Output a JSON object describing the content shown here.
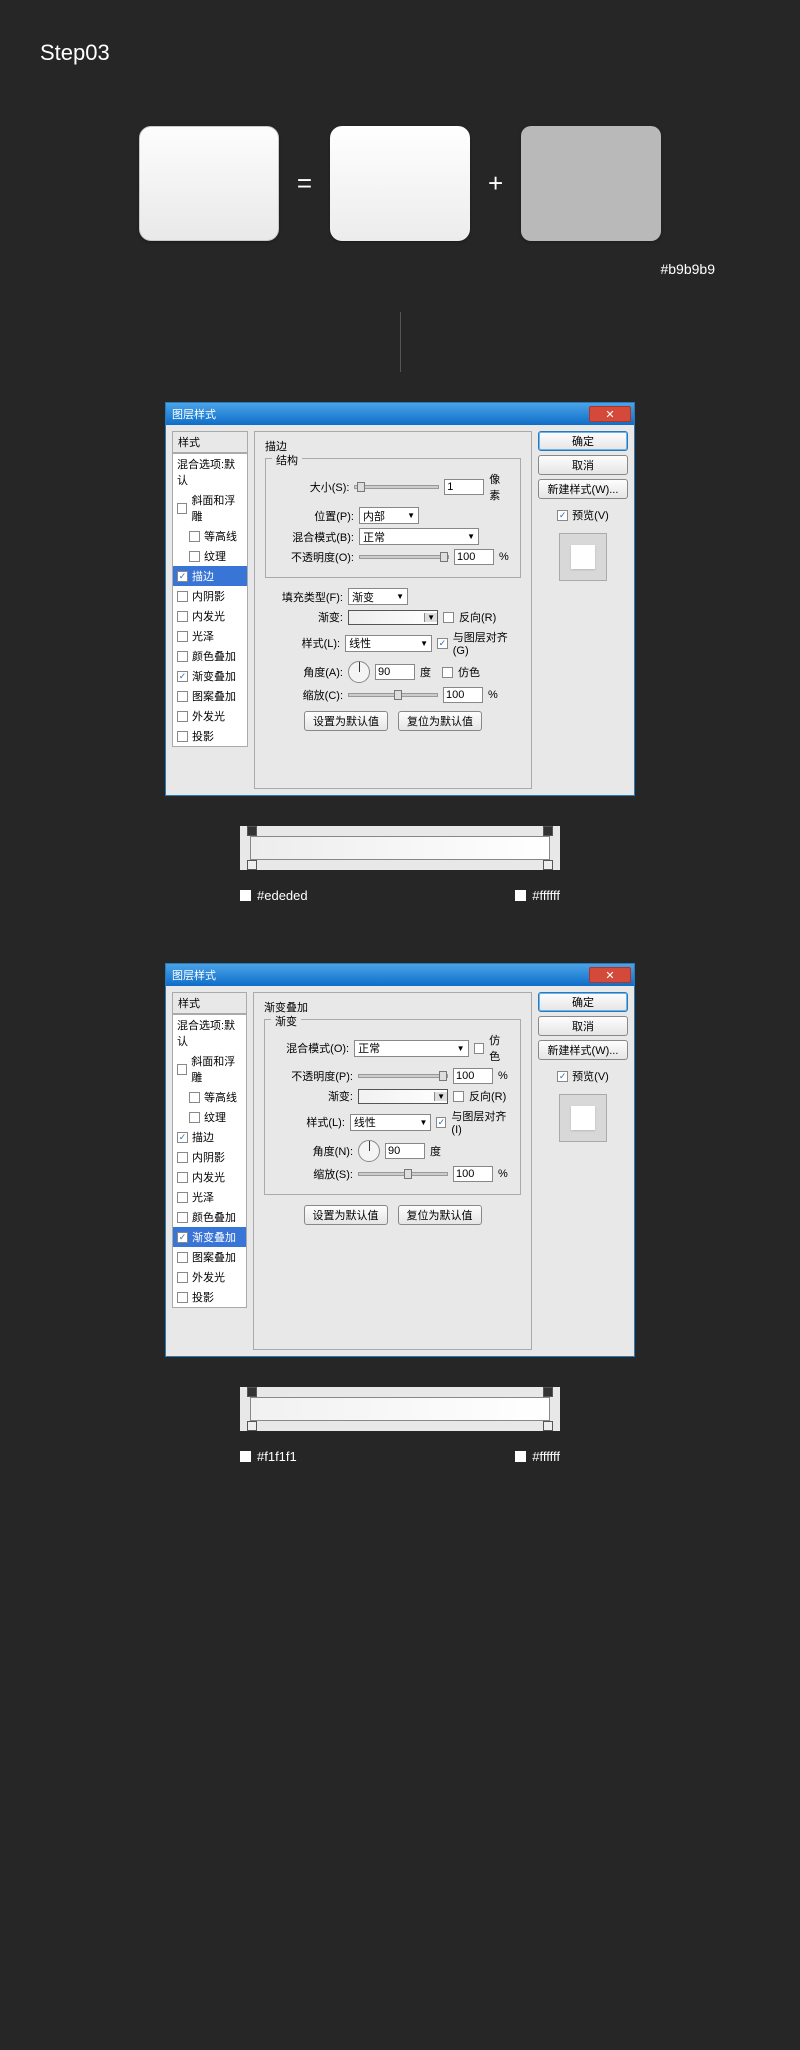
{
  "step_title": "Step03",
  "composition": {
    "eq_sign": "=",
    "plus_sign": "+",
    "gray_hex": "#b9b9b9"
  },
  "dialog_title": "图层样式",
  "styles": {
    "header": "样式",
    "blend_options": "混合选项:默认",
    "items": [
      {
        "label": "斜面和浮雕",
        "checked": false
      },
      {
        "label": "等高线",
        "checked": false,
        "indent": true
      },
      {
        "label": "纹理",
        "checked": false,
        "indent": true
      },
      {
        "label": "描边",
        "checked": true
      },
      {
        "label": "内阴影",
        "checked": false
      },
      {
        "label": "内发光",
        "checked": false
      },
      {
        "label": "光泽",
        "checked": false
      },
      {
        "label": "颜色叠加",
        "checked": false
      },
      {
        "label": "渐变叠加",
        "checked": true
      },
      {
        "label": "图案叠加",
        "checked": false
      },
      {
        "label": "外发光",
        "checked": false
      },
      {
        "label": "投影",
        "checked": false
      }
    ]
  },
  "stroke_panel": {
    "title": "描边",
    "structure_title": "结构",
    "size_label": "大小(S):",
    "size_value": "1",
    "size_unit": "像素",
    "position_label": "位置(P):",
    "position_value": "内部",
    "blendmode_label": "混合模式(B):",
    "blendmode_value": "正常",
    "opacity_label": "不透明度(O):",
    "opacity_value": "100",
    "opacity_unit": "%",
    "filltype_label": "填充类型(F):",
    "filltype_value": "渐变",
    "gradient_label": "渐变:",
    "reverse_label": "反向(R)",
    "style_label": "样式(L):",
    "style_value": "线性",
    "align_label": "与图层对齐(G)",
    "angle_label": "角度(A):",
    "angle_value": "90",
    "angle_unit": "度",
    "dither_label": "仿色",
    "scale_label": "缩放(C):",
    "scale_value": "100",
    "scale_unit": "%",
    "default_btn": "设置为默认值",
    "reset_btn": "复位为默认值"
  },
  "gradient_overlay_panel": {
    "title": "渐变叠加",
    "subtitle": "渐变",
    "blendmode_label": "混合模式(O):",
    "blendmode_value": "正常",
    "dither_label": "仿色",
    "opacity_label": "不透明度(P):",
    "opacity_value": "100",
    "opacity_unit": "%",
    "gradient_label": "渐变:",
    "reverse_label": "反向(R)",
    "style_label": "样式(L):",
    "style_value": "线性",
    "align_label": "与图层对齐(I)",
    "angle_label": "角度(N):",
    "angle_value": "90",
    "angle_unit": "度",
    "scale_label": "缩放(S):",
    "scale_value": "100",
    "scale_unit": "%",
    "default_btn": "设置为默认值",
    "reset_btn": "复位为默认值"
  },
  "right": {
    "ok": "确定",
    "cancel": "取消",
    "new_style": "新建样式(W)...",
    "preview": "预览(V)"
  },
  "gradient1": {
    "left": "#ededed",
    "right": "#ffffff"
  },
  "gradient2": {
    "left": "#f1f1f1",
    "right": "#ffffff"
  },
  "dialog1_selected": 3,
  "dialog2_selected": 8
}
